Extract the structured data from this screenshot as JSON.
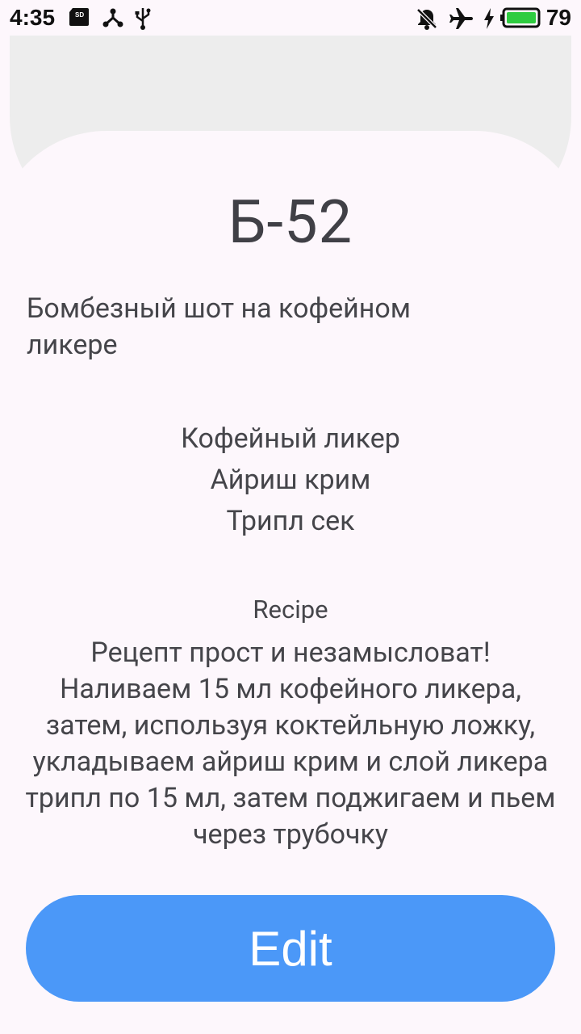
{
  "status_bar": {
    "time": "4:35",
    "battery_level": "79",
    "left_icons": [
      "sd-card-icon",
      "graph-icon",
      "usb-icon"
    ],
    "right_icons": [
      "notifications-off-icon",
      "airplane-mode-icon",
      "charging-icon",
      "battery-icon"
    ],
    "battery_color": "#2ecc40"
  },
  "drink": {
    "title": "Б-52",
    "description": "Бомбезный шот на кофейном ликере",
    "ingredients": [
      "Кофейный ликер",
      "Айриш крим",
      "Трипл сек"
    ],
    "recipe_label": "Recipe",
    "recipe_text": "Рецепт прост и незамысловат! Наливаем 15 мл кофейного ликера, затем, используя коктейльную ложку, укладываем айриш крим и слой ликера трипл по 15 мл, затем поджигаем и пьем через трубочку"
  },
  "actions": {
    "edit_label": "Edit"
  },
  "colors": {
    "accent": "#4b98f8",
    "background": "#fdf7fc",
    "text": "#45454a"
  }
}
